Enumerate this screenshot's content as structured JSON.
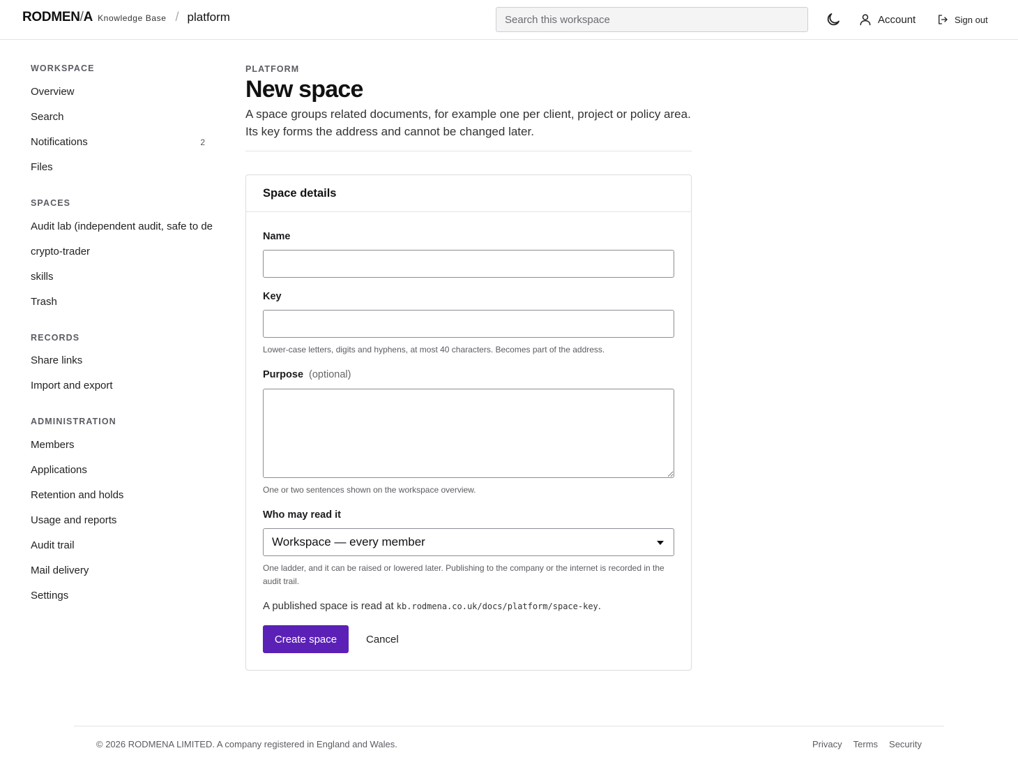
{
  "header": {
    "logo": "RODMEN",
    "logo_slash": "/",
    "logo_end": "A",
    "product": "Knowledge Base",
    "crumb_sep": "/",
    "workspace": "platform",
    "search_placeholder": "Search this workspace",
    "account_label": "Account",
    "signout_label": "Sign out"
  },
  "sidebar": {
    "sections": [
      {
        "heading": "Workspace",
        "items": [
          "Overview",
          "Search",
          "Notifications",
          "Files"
        ]
      },
      {
        "heading": "Spaces",
        "items": [
          "Audit lab (independent audit, safe to de",
          "crypto-trader",
          "skills",
          "Trash"
        ]
      },
      {
        "heading": "Records",
        "items": [
          "Share links",
          "Import and export"
        ]
      },
      {
        "heading": "Administration",
        "items": [
          "Members",
          "Applications",
          "Retention and holds",
          "Usage and reports",
          "Audit trail",
          "Mail delivery",
          "Settings"
        ]
      }
    ],
    "notifications_count": "2"
  },
  "main": {
    "eyebrow": "PLATFORM",
    "title": "New space",
    "description": "A space groups related documents, for example one per client, project or policy area. Its key forms the address and cannot be changed later.",
    "card_title": "Space details",
    "name_label": "Name",
    "name_value": "",
    "key_label": "Key",
    "key_value": "",
    "key_hint": "Lower-case letters, digits and hyphens, at most 40 characters. Becomes part of the address.",
    "purpose_label": "Purpose",
    "purpose_optional": "(optional)",
    "purpose_value": "",
    "purpose_hint": "One or two sentences shown on the workspace overview.",
    "read_label": "Who may read it",
    "read_value": "Workspace — every member",
    "read_hint": "One ladder, and it can be raised or lowered later. Publishing to the company or the internet is recorded in the audit trail.",
    "published_prefix": "A published space is read at ",
    "published_url": "kb.rodmena.co.uk/docs/platform/space-key",
    "published_suffix": ".",
    "create_label": "Create space",
    "cancel_label": "Cancel"
  },
  "footer": {
    "copyright": "© 2026 RODMENA LIMITED. A company registered in England and Wales.",
    "links": [
      "Privacy",
      "Terms",
      "Security"
    ]
  },
  "colors": {
    "primary": "#5b21b6",
    "border": "#dcdce0",
    "muted_text": "#5b5b63"
  },
  "icons": {
    "theme": "moon-icon",
    "account": "user-icon",
    "signout": "sign-out-icon",
    "select": "caret-down-icon"
  }
}
